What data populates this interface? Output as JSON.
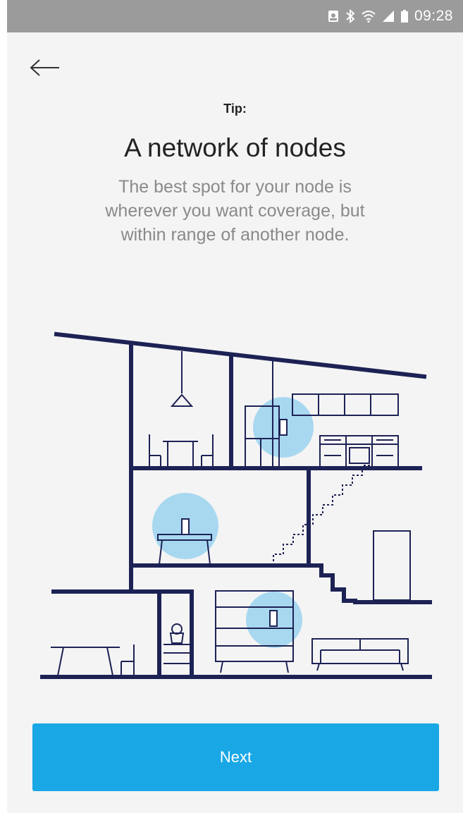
{
  "status_bar": {
    "time": "09:28",
    "icons": [
      "photo-icon",
      "bluetooth-icon",
      "wifi-icon",
      "signal-icon",
      "battery-icon"
    ]
  },
  "header": {
    "back_icon": "arrow-left-icon"
  },
  "content": {
    "tip_label": "Tip:",
    "title": "A network of nodes",
    "description_lines": [
      "The best spot for your node is",
      "wherever you want coverage, but",
      "within range of another node."
    ]
  },
  "illustration": {
    "name": "house-nodes-illustration",
    "line_color": "#1d2255",
    "coverage_color": "#a8d8f0"
  },
  "footer": {
    "next_label": "Next"
  },
  "colors": {
    "accent": "#19a7e6",
    "status_bar": "#9b9b9b",
    "background": "#f4f4f4"
  }
}
